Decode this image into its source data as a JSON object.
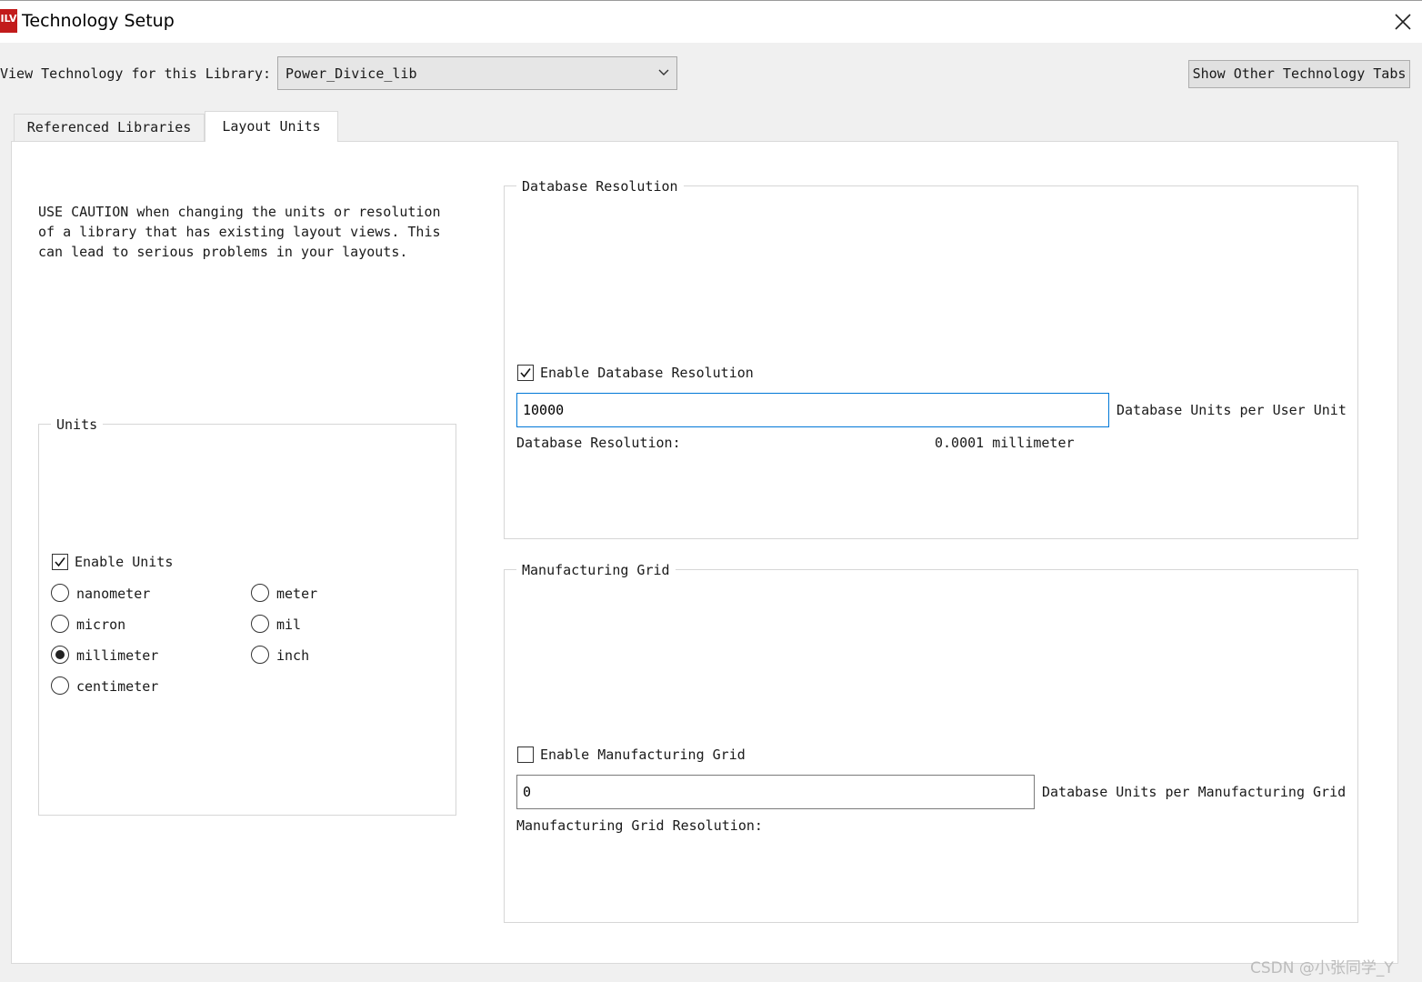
{
  "window": {
    "title": "Technology Setup",
    "icon_text": "ILV"
  },
  "library": {
    "label": "View Technology for this Library:",
    "selected": "Power_Divice_lib"
  },
  "show_other_tabs_label": "Show Other Technology Tabs",
  "tabs": [
    {
      "label": "Referenced Libraries",
      "active": false
    },
    {
      "label": "Layout Units",
      "active": true
    }
  ],
  "caution_text": "USE CAUTION when changing the units or resolution\nof a library that has existing layout views. This\ncan lead to serious problems in your layouts.",
  "units": {
    "title": "Units",
    "enable_label": "Enable Units",
    "enabled": true,
    "options": [
      "nanometer",
      "micron",
      "millimeter",
      "centimeter",
      "meter",
      "mil",
      "inch"
    ],
    "selected": "millimeter"
  },
  "db_resolution": {
    "title": "Database Resolution",
    "enable_label": "Enable Database Resolution",
    "enabled": true,
    "value": "10000",
    "units_label": "Database Units per User Unit",
    "resolution_label": "Database Resolution:",
    "resolution_value": "0.0001 millimeter"
  },
  "mfg_grid": {
    "title": "Manufacturing Grid",
    "enable_label": "Enable Manufacturing Grid",
    "enabled": false,
    "value": "0",
    "units_label": "Database Units per Manufacturing Grid",
    "resolution_label": "Manufacturing Grid Resolution:"
  },
  "watermark": "CSDN @小张同学_Y",
  "colors": {
    "accent": "#0078d7",
    "icon_red": "#c21b1b",
    "panel_bg": "#ffffff",
    "window_bg": "#f0f0f0"
  }
}
